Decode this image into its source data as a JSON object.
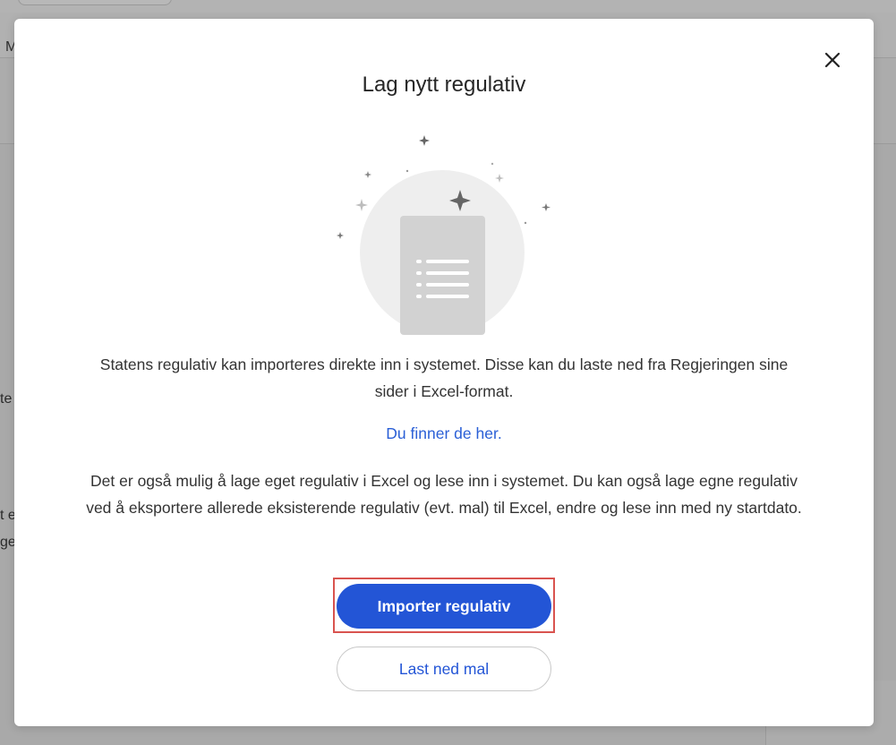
{
  "background": {
    "toolbar_letter": "M",
    "fragment_1": "te",
    "fragment_2": "t e",
    "fragment_3": "ge"
  },
  "modal": {
    "title": "Lag nytt regulativ",
    "close_icon": "close-icon",
    "illustration_icon": "document-list-icon",
    "paragraph_1": "Statens regulativ kan importeres direkte inn i systemet. Disse kan du laste ned fra Regjeringen sine sider i Excel-format.",
    "link_text": "Du finner de her.",
    "paragraph_2": "Det er også mulig å lage eget regulativ i Excel og lese inn i systemet. Du kan også lage egne regulativ ved å eksportere allerede eksisterende regulativ (evt. mal) til Excel, endre og lese inn med ny startdato.",
    "primary_button": "Importer regulativ",
    "secondary_button": "Last ned mal"
  },
  "colors": {
    "accent": "#2355d6",
    "highlight_border": "#d9534f",
    "link": "#2a5fd6"
  }
}
